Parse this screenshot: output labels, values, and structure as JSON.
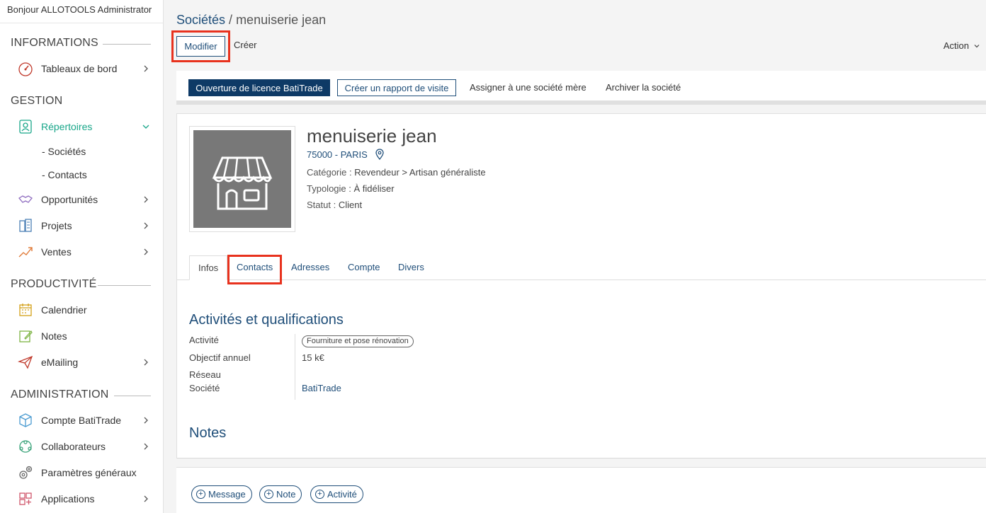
{
  "user": {
    "greeting": "Bonjour ALLOTOOLS Administrator"
  },
  "sidebar": {
    "sections": [
      {
        "title": "INFORMATIONS"
      },
      {
        "title": "GESTION"
      },
      {
        "title": "PRODUCTIVITÉ"
      },
      {
        "title": "ADMINISTRATION"
      }
    ],
    "items": [
      {
        "label": "Tableaux de bord"
      },
      {
        "label": "Répertoires"
      },
      {
        "label": "Opportunités"
      },
      {
        "label": "Projets"
      },
      {
        "label": "Ventes"
      },
      {
        "label": "Calendrier"
      },
      {
        "label": "Notes"
      },
      {
        "label": "eMailing"
      },
      {
        "label": "Compte BatiTrade"
      },
      {
        "label": "Collaborateurs"
      },
      {
        "label": "Paramètres généraux"
      },
      {
        "label": "Applications"
      }
    ],
    "subitems": [
      {
        "label": "- Sociétés"
      },
      {
        "label": "- Contacts"
      }
    ]
  },
  "breadcrumb": {
    "parent": "Sociétés",
    "separator": " / ",
    "current": "menuiserie jean"
  },
  "toolbar": {
    "modifier": "Modifier",
    "creer": "Créer",
    "action": "Action"
  },
  "actions": {
    "licence": "Ouverture de licence BatiTrade",
    "rapport": "Créer un rapport de visite",
    "assigner": "Assigner à une société mère",
    "archiver": "Archiver la société"
  },
  "company": {
    "name": "menuiserie jean",
    "location": "75000 - PARIS",
    "categorie_label": "Catégorie :",
    "categorie": "Revendeur > Artisan généraliste",
    "typologie_label": "Typologie :",
    "typologie": "À fidéliser",
    "statut_label": "Statut :",
    "statut": "Client"
  },
  "tabs": [
    {
      "label": "Infos"
    },
    {
      "label": "Contacts"
    },
    {
      "label": "Adresses"
    },
    {
      "label": "Compte"
    },
    {
      "label": "Divers"
    }
  ],
  "infos": {
    "heading": "Activités et qualifications",
    "activite_label": "Activité",
    "activite_tag": "Fourniture et pose rénovation",
    "objectif_label": "Objectif annuel",
    "objectif_value": "15 k€",
    "reseau_label": "Réseau",
    "societe_label": "Société",
    "societe_value": "BatiTrade",
    "notes_heading": "Notes"
  },
  "chatter": {
    "message": "Message",
    "note": "Note",
    "activite": "Activité"
  },
  "colors": {
    "accent": "#1f4e79",
    "active": "#18a689",
    "highlight": "#e8321e",
    "primary_btn": "#0e3a66"
  }
}
